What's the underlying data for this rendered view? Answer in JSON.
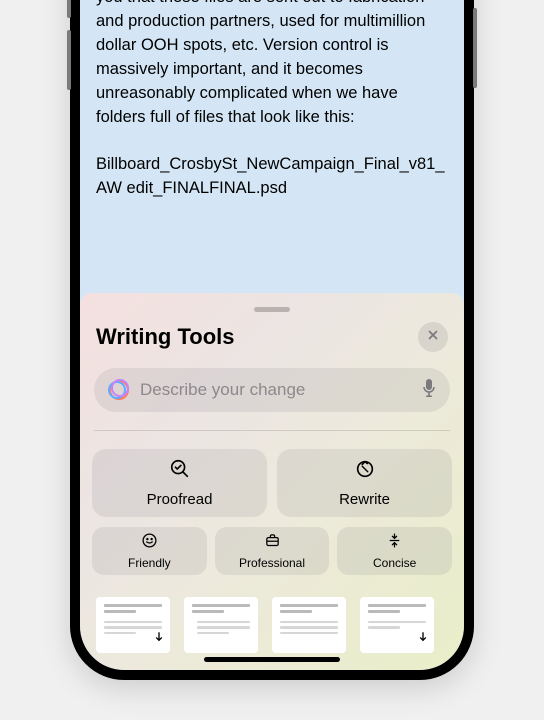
{
  "content": {
    "paragraph": "kicked off this project. Surely I needn't remind you that these files are sent out to fabrication and production partners, used for multimillion dollar OOH spots, etc. Version control is massively important, and it becomes unreasonably complicated when we have folders full of files that look like this:",
    "filename": "Billboard_CrosbySt_NewCampaign_Final_v81_AW edit_FINALFINAL.psd"
  },
  "sheet": {
    "title": "Writing Tools",
    "input_placeholder": "Describe your change",
    "actions": {
      "proofread": "Proofread",
      "rewrite": "Rewrite",
      "friendly": "Friendly",
      "professional": "Professional",
      "concise": "Concise"
    }
  }
}
